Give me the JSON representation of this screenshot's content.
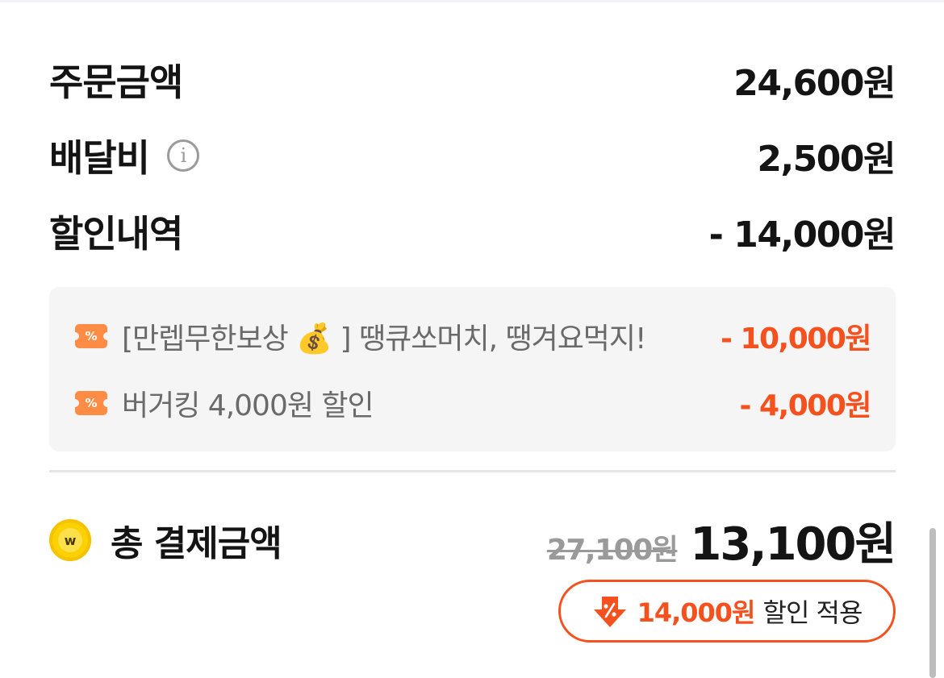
{
  "summary": {
    "order_label": "주문금액",
    "order_value": "24,600원",
    "delivery_label": "배달비",
    "delivery_value": "2,500원",
    "discount_label": "할인내역",
    "discount_value": "- 14,000원"
  },
  "discounts": [
    {
      "name": "[만렙무한보상 💰 ] 땡큐쏘머치, 땡겨요먹지!",
      "amount": "- 10,000원"
    },
    {
      "name": "버거킹 4,000원 할인",
      "amount": "- 4,000원"
    }
  ],
  "total": {
    "label": "총 결제금액",
    "original_price": "27,100원",
    "final_price": "13,100원",
    "coin_symbol": "w",
    "badge_amount": "14,000원",
    "badge_text": "할인 적용"
  },
  "icons": {
    "info": "i",
    "coupon": "%"
  },
  "colors": {
    "accent": "#f4511e",
    "coupon": "#ff8c45",
    "coin": "#fbd100"
  }
}
